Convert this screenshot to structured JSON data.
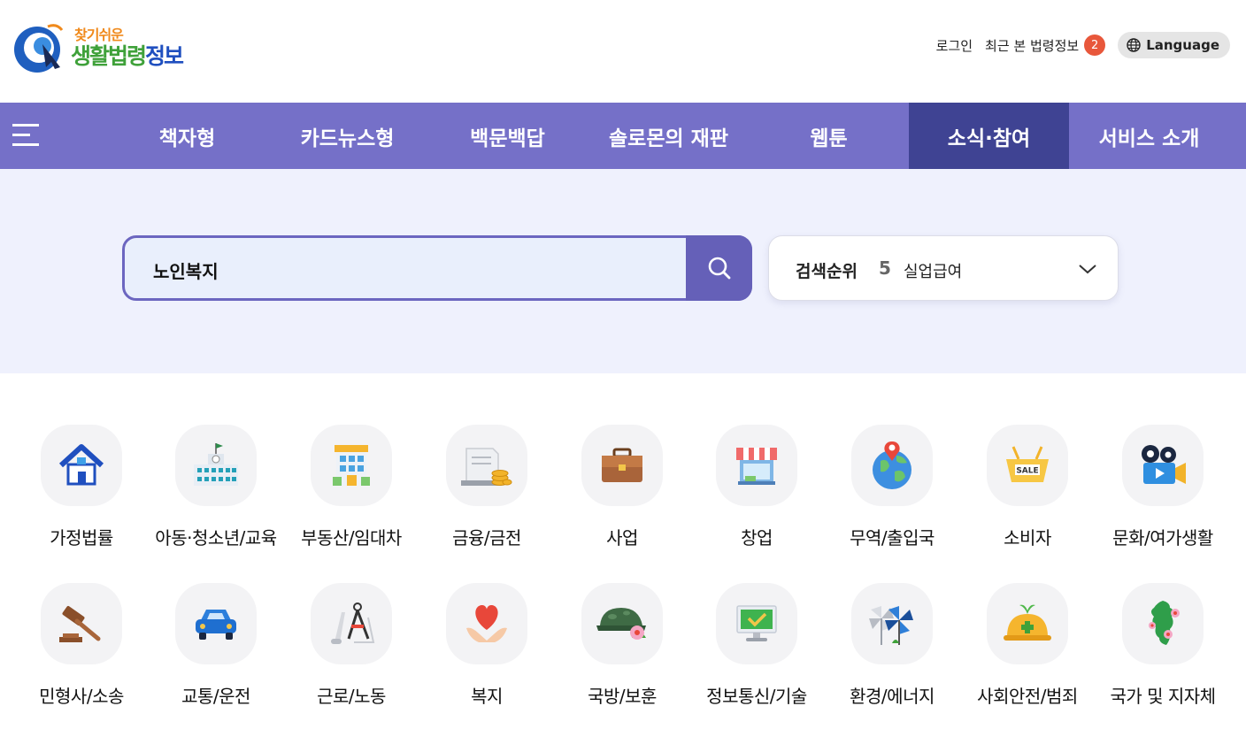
{
  "logo": {
    "top_text": "찾기쉬운",
    "main_text_1": "생활법령",
    "main_text_2": "정보"
  },
  "util": {
    "login": "로그인",
    "recent": "최근 본 법령정보",
    "recent_count": "2",
    "language": "Language"
  },
  "nav": {
    "items": [
      "책자형",
      "카드뉴스형",
      "백문백답",
      "솔로몬의 재판",
      "웹툰",
      "소식·참여",
      "서비스 소개"
    ],
    "active_index": 5
  },
  "search": {
    "value": "노인복지",
    "rank_label": "검색순위",
    "rank_number": "5",
    "rank_term": "실업급여"
  },
  "categories": [
    {
      "label": "가정법률",
      "icon": "house-icon"
    },
    {
      "label": "아동·청소년/교육",
      "icon": "school-icon"
    },
    {
      "label": "부동산/임대차",
      "icon": "building-icon"
    },
    {
      "label": "금융/금전",
      "icon": "money-icon"
    },
    {
      "label": "사업",
      "icon": "briefcase-icon"
    },
    {
      "label": "창업",
      "icon": "store-icon"
    },
    {
      "label": "무역/출입국",
      "icon": "globe-icon"
    },
    {
      "label": "소비자",
      "icon": "sale-basket-icon"
    },
    {
      "label": "문화/여가생활",
      "icon": "video-camera-icon"
    },
    {
      "label": "민형사/소송",
      "icon": "gavel-icon"
    },
    {
      "label": "교통/운전",
      "icon": "car-icon"
    },
    {
      "label": "근로/노동",
      "icon": "compass-icon"
    },
    {
      "label": "복지",
      "icon": "heart-hands-icon"
    },
    {
      "label": "국방/보훈",
      "icon": "helmet-icon"
    },
    {
      "label": "정보통신/기술",
      "icon": "monitor-icon"
    },
    {
      "label": "환경/에너지",
      "icon": "pinwheel-icon"
    },
    {
      "label": "사회안전/범죄",
      "icon": "safety-hat-icon"
    },
    {
      "label": "국가 및 지자체",
      "icon": "korea-map-icon"
    }
  ]
}
